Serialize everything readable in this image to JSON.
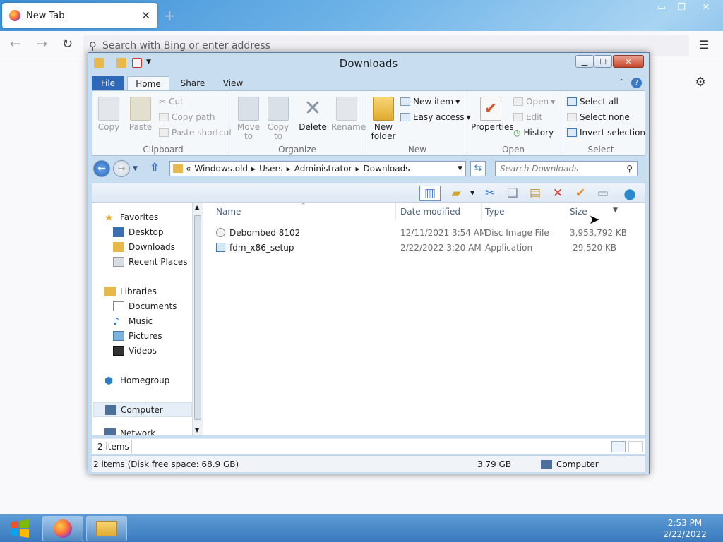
{
  "firefox": {
    "tab_title": "New Tab",
    "tab_close": "✕",
    "new_tab": "+",
    "url_placeholder": "Search with Bing or enter address",
    "sys_buttons": [
      "▭",
      "❐",
      "✕"
    ]
  },
  "explorer": {
    "title": "Downloads",
    "ribbon_tabs": [
      "File",
      "Home",
      "Share",
      "View"
    ],
    "clipboard": {
      "copy": "Copy",
      "paste": "Paste",
      "cut": "Cut",
      "copy_path": "Copy path",
      "paste_shortcut": "Paste shortcut",
      "group": "Clipboard"
    },
    "organize": {
      "move_to": "Move to",
      "copy_to": "Copy to",
      "delete": "Delete",
      "rename": "Rename",
      "group": "Organize"
    },
    "new": {
      "new_folder": "New folder",
      "new_item": "New item",
      "easy_access": "Easy access",
      "group": "New"
    },
    "open": {
      "properties": "Properties",
      "open": "Open",
      "edit": "Edit",
      "history": "History",
      "group": "Open"
    },
    "select": {
      "select_all": "Select all",
      "select_none": "Select none",
      "invert": "Invert selection",
      "group": "Select"
    },
    "address": {
      "prefix": "«",
      "segments": [
        "Windows.old",
        "Users",
        "Administrator",
        "Downloads"
      ],
      "search_placeholder": "Search Downloads"
    },
    "nav": {
      "favorites": "Favorites",
      "desktop": "Desktop",
      "downloads": "Downloads",
      "recent": "Recent Places",
      "libraries": "Libraries",
      "documents": "Documents",
      "music": "Music",
      "pictures": "Pictures",
      "videos": "Videos",
      "homegroup": "Homegroup",
      "computer": "Computer",
      "network": "Network"
    },
    "columns": [
      "Name",
      "Date modified",
      "Type",
      "Size"
    ],
    "files": [
      {
        "name": "Debombed 8102",
        "date": "12/11/2021 3:54 AM",
        "type": "Disc Image File",
        "size": "3,953,792 KB"
      },
      {
        "name": "fdm_x86_setup",
        "date": "2/22/2022 3:20 AM",
        "type": "Application",
        "size": "29,520 KB"
      }
    ],
    "item_count": "2 items",
    "status": {
      "left": "2 items (Disk free space: 68.9 GB)",
      "size": "3.79 GB",
      "location": "Computer"
    }
  },
  "taskbar": {
    "time": "2:53 PM",
    "date": "2/22/2022"
  }
}
